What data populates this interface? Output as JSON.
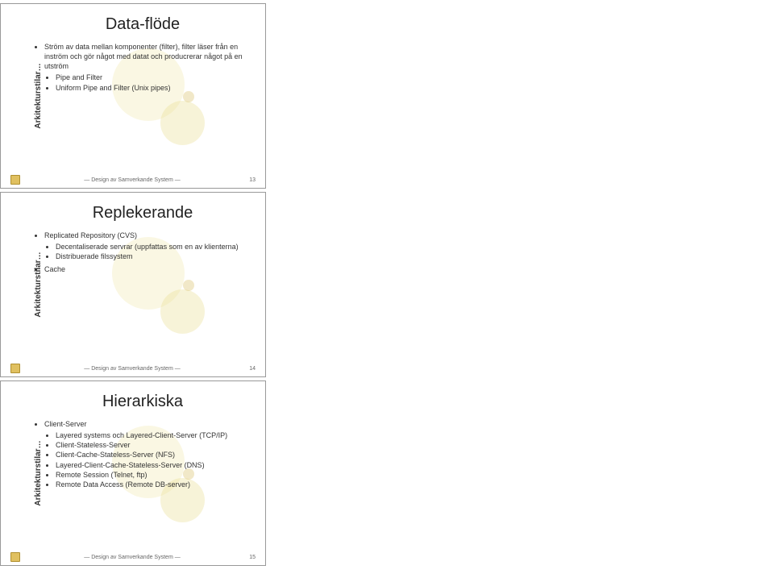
{
  "slides": [
    {
      "sidebar": "Arkitekturstilar…",
      "title": "Data-flöde",
      "bullets": [
        {
          "text": "Ström av data mellan komponenter (filter), filter läser från en inström och gör något med datat och producrerar något på en utström",
          "children": [
            {
              "text": "Pipe and Filter"
            },
            {
              "text": "Uniform Pipe and Filter (Unix pipes)"
            }
          ]
        }
      ],
      "footer": "— Design av Samverkande System —",
      "page": "13"
    },
    {
      "sidebar": "Arkitekturstilar…",
      "title": "Replekerande",
      "bullets": [
        {
          "text": "Replicated Repository (CVS)",
          "children": [
            {
              "text": "Decentaliserade servrar (uppfattas som en av klienterna)"
            },
            {
              "text": "Distribuerade filssystem"
            }
          ]
        },
        {
          "text": "Cache"
        }
      ],
      "footer": "— Design av Samverkande System —",
      "page": "14"
    },
    {
      "sidebar": "Arkitekturstilar…",
      "title": "Hierarkiska",
      "bullets": [
        {
          "text": "Client-Server",
          "children": [
            {
              "text": "Layered systems och Layered-Client-Server (TCP/IP)"
            },
            {
              "text": "Client-Stateless-Server"
            },
            {
              "text": "Client-Cache-Stateless-Server (NFS)"
            },
            {
              "text": "Layered-Client-Cache-Stateless-Server (DNS)"
            },
            {
              "text": "Remote Session (Telnet, ftp)"
            },
            {
              "text": "Remote Data Access (Remote DB-server)"
            }
          ]
        }
      ],
      "footer": "— Design av Samverkande System —",
      "page": "15"
    }
  ]
}
